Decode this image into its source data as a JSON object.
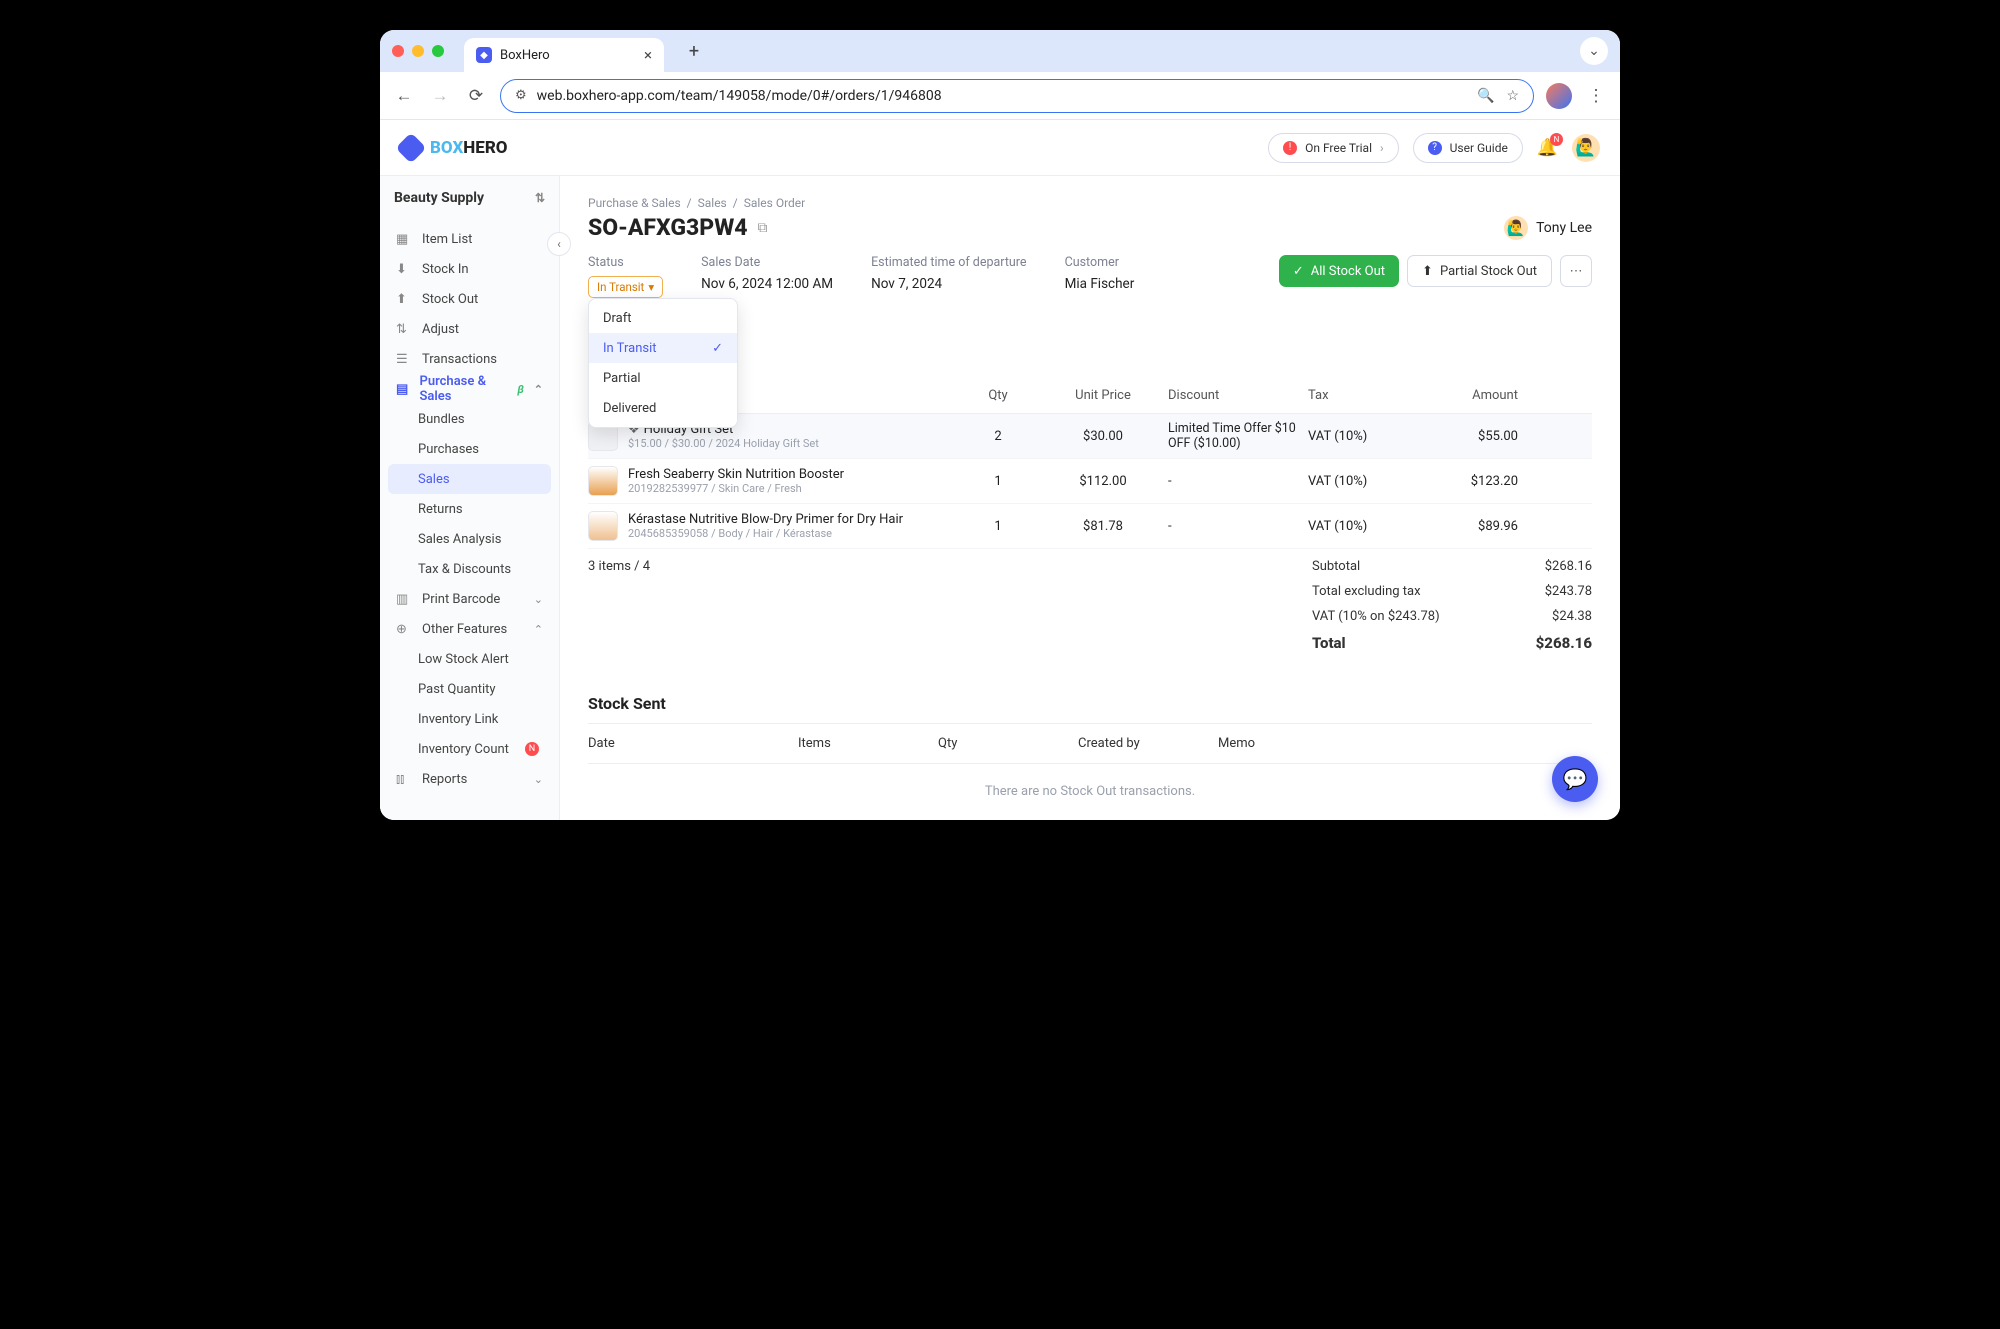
{
  "browser": {
    "tab_title": "BoxHero",
    "url": "web.boxhero-app.com/team/149058/mode/0#/orders/1/946808"
  },
  "app_header": {
    "logo_a": "BOX",
    "logo_b": "HERO",
    "trial_label": "On Free Trial",
    "guide_label": "User Guide",
    "bell_badge": "N"
  },
  "sidebar": {
    "workspace": "Beauty Supply",
    "items": {
      "item_list": "Item List",
      "stock_in": "Stock In",
      "stock_out": "Stock Out",
      "adjust": "Adjust",
      "transactions": "Transactions",
      "purchase_sales": "Purchase & Sales",
      "bundles": "Bundles",
      "purchases": "Purchases",
      "sales": "Sales",
      "returns": "Returns",
      "sales_analysis": "Sales Analysis",
      "tax_discounts": "Tax & Discounts",
      "print_barcode": "Print Barcode",
      "other_features": "Other Features",
      "low_stock": "Low Stock Alert",
      "past_qty": "Past Quantity",
      "inv_link": "Inventory Link",
      "inv_count": "Inventory Count",
      "reports": "Reports"
    }
  },
  "breadcrumbs": [
    "Purchase & Sales",
    "Sales",
    "Sales Order"
  ],
  "order": {
    "id": "SO-AFXG3PW4",
    "owner": "Tony Lee",
    "status_label": "Status",
    "status_value": "In Transit",
    "sales_date_label": "Sales Date",
    "sales_date_value": "Nov 6, 2024 12:00 AM",
    "etd_label": "Estimated time of departure",
    "etd_value": "Nov 7, 2024",
    "customer_label": "Customer",
    "customer_value": "Mia Fischer"
  },
  "status_options": {
    "draft": "Draft",
    "in_transit": "In Transit",
    "partial": "Partial",
    "delivered": "Delivered"
  },
  "buttons": {
    "all_stock_out": "All Stock Out",
    "partial_stock_out": "Partial Stock Out"
  },
  "table": {
    "headers": {
      "item": "",
      "qty": "Qty",
      "unit": "Unit Price",
      "discount": "Discount",
      "tax": "Tax",
      "amount": "Amount"
    },
    "rows": [
      {
        "name": "Holiday Gift Set",
        "bundle": true,
        "sub": "$15.00 / $30.00 / 2024 Holiday Gift Set",
        "qty": "2",
        "unit": "$30.00",
        "discount": "Limited Time Offer $10 OFF ($10.00)",
        "tax": "VAT (10%)",
        "amount": "$55.00"
      },
      {
        "name": "Fresh Seaberry Skin Nutrition Booster",
        "bundle": false,
        "sub": "2019282539977 / Skin Care / Fresh",
        "qty": "1",
        "unit": "$112.00",
        "discount": "-",
        "tax": "VAT (10%)",
        "amount": "$123.20"
      },
      {
        "name": "Kérastase Nutritive Blow-Dry Primer for Dry Hair",
        "bundle": false,
        "sub": "2045685359058 / Body / Hair / Kérastase",
        "qty": "1",
        "unit": "$81.78",
        "discount": "-",
        "tax": "VAT (10%)",
        "amount": "$89.96"
      }
    ],
    "count_text": "3 items / 4"
  },
  "summary": {
    "subtotal_l": "Subtotal",
    "subtotal_v": "$268.16",
    "excl_l": "Total excluding tax",
    "excl_v": "$243.78",
    "vat_l": "VAT (10% on $243.78)",
    "vat_v": "$24.38",
    "total_l": "Total",
    "total_v": "$268.16"
  },
  "stock_sent": {
    "heading": "Stock Sent",
    "headers": {
      "date": "Date",
      "items": "Items",
      "qty": "Qty",
      "created": "Created by",
      "memo": "Memo"
    },
    "empty": "There are no Stock Out transactions."
  }
}
